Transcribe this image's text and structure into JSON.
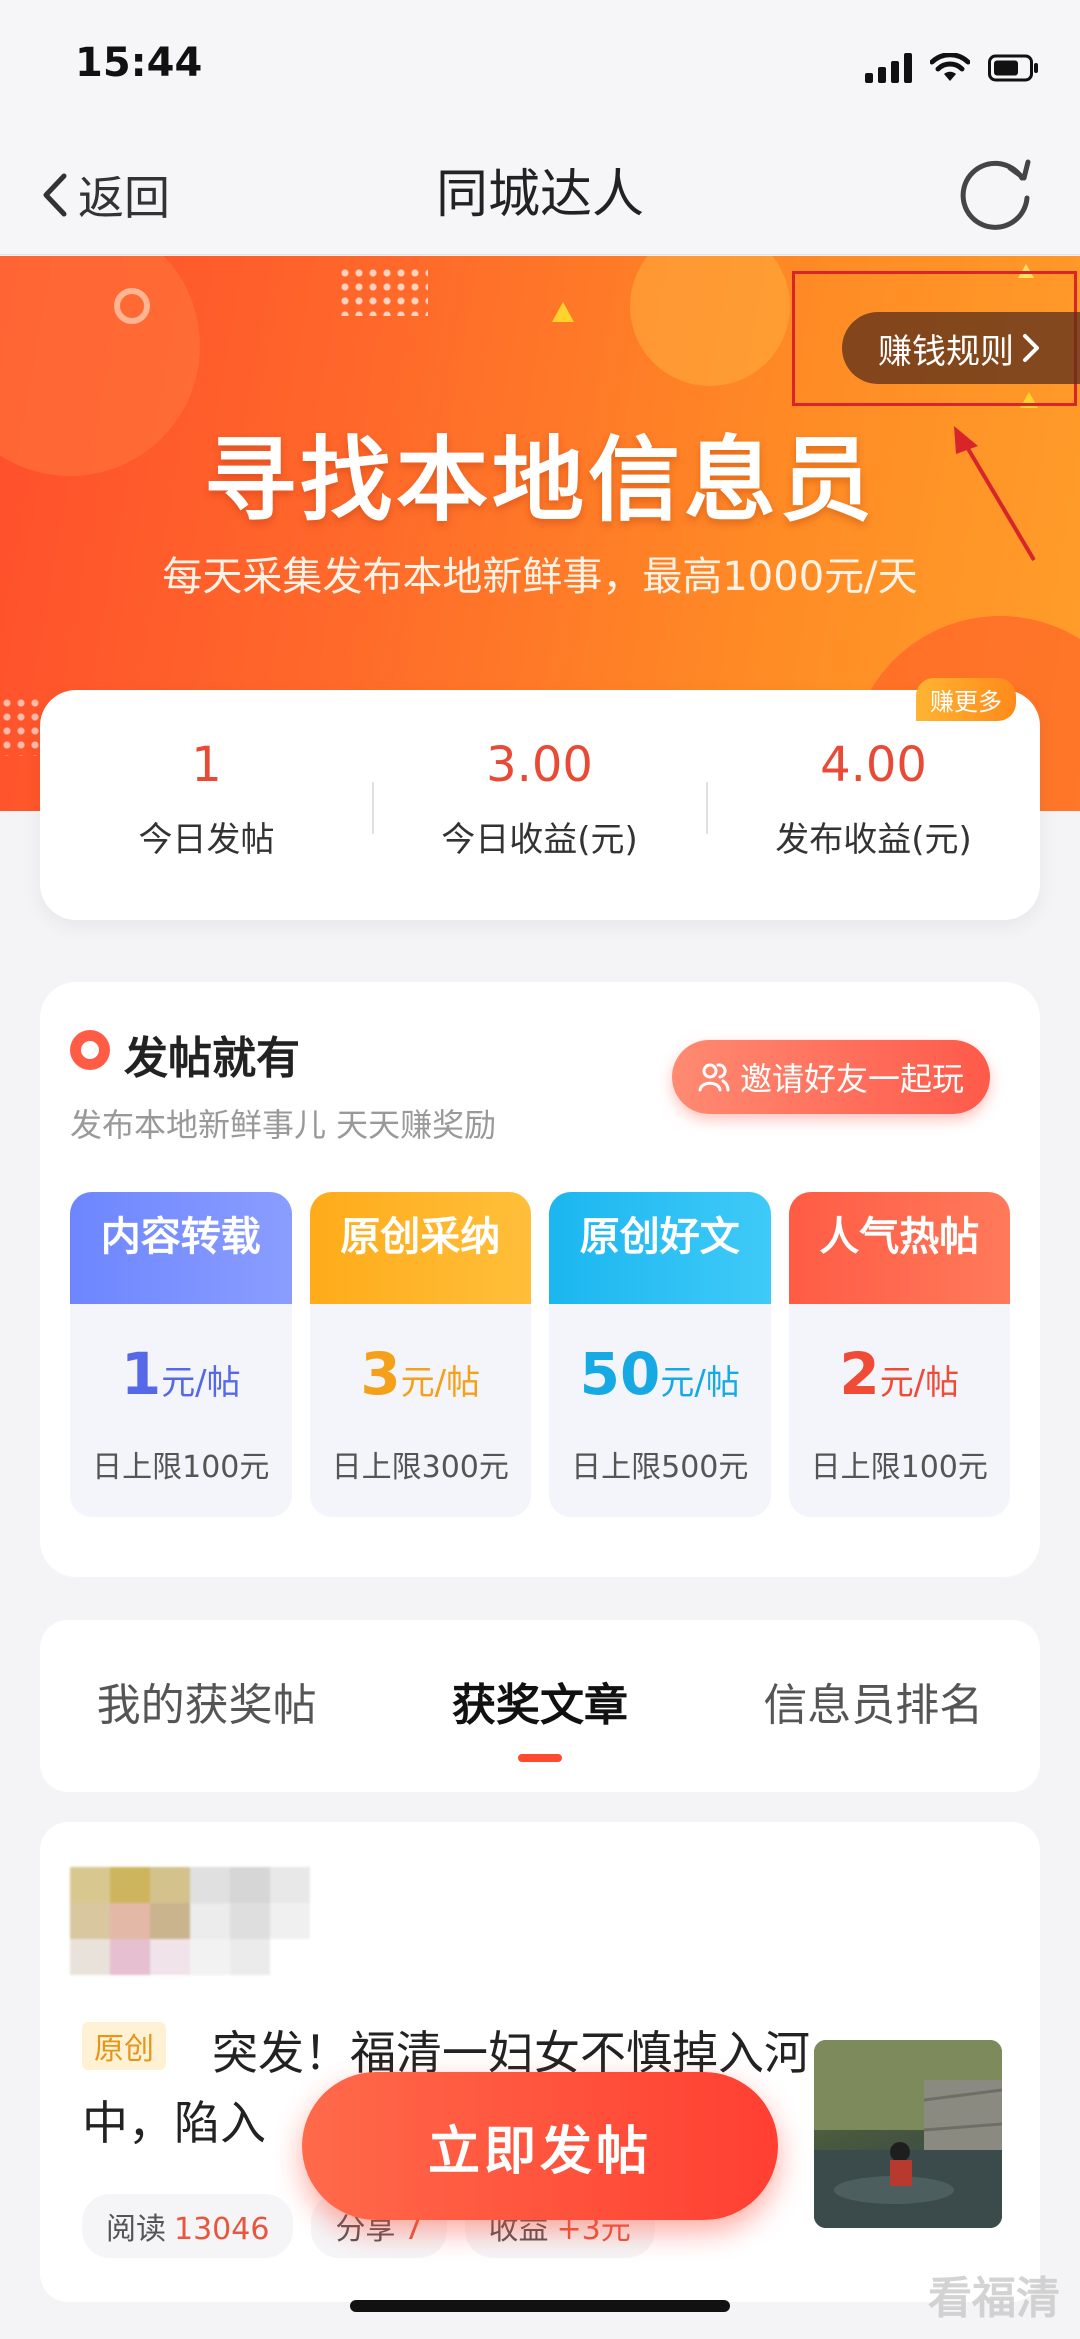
{
  "status_bar": {
    "time": "15:44"
  },
  "nav": {
    "back_label": "返回",
    "title": "同城达人"
  },
  "banner": {
    "rules_label": "赚钱规则",
    "title": "寻找本地信息员",
    "subtitle": "每天采集发布本地新鲜事，最高1000元/天"
  },
  "stats": {
    "items": [
      {
        "value": "1",
        "label": "今日发帖"
      },
      {
        "value": "3.00",
        "label": "今日收益(元)"
      },
      {
        "value": "4.00",
        "label": "发布收益(元)"
      }
    ],
    "badge": "赚更多"
  },
  "rewards": {
    "title": "发帖就有",
    "subtitle": "发布本地新鲜事儿 天天赚奖励",
    "invite_label": "邀请好友一起玩",
    "tiers": [
      {
        "name": "内容转载",
        "amount": "1",
        "unit": "元/帖",
        "limit": "日上限100元",
        "color_from": "#6d86ff",
        "color_to": "#8a9dff",
        "price_color": "#5468e8"
      },
      {
        "name": "原创采纳",
        "amount": "3",
        "unit": "元/帖",
        "limit": "日上限300元",
        "color_from": "#ffab1a",
        "color_to": "#ffbf3a",
        "price_color": "#f5a019"
      },
      {
        "name": "原创好文",
        "amount": "50",
        "unit": "元/帖",
        "limit": "日上限500元",
        "color_from": "#1bb6f0",
        "color_to": "#3fcaf8",
        "price_color": "#16a9e3"
      },
      {
        "name": "人气热帖",
        "amount": "2",
        "unit": "元/帖",
        "limit": "日上限100元",
        "color_from": "#ff5b45",
        "color_to": "#ff7a5a",
        "price_color": "#ef4b37"
      }
    ]
  },
  "tabs": [
    {
      "label": "我的获奖帖",
      "active": false
    },
    {
      "label": "获奖文章",
      "active": true
    },
    {
      "label": "信息员排名",
      "active": false
    }
  ],
  "article": {
    "tag": "原创",
    "title": "突发！福清一妇女不慎掉入河中，陷入",
    "metrics": [
      {
        "label": "阅读",
        "value": "13046"
      },
      {
        "label": "分享",
        "value": "7"
      },
      {
        "label": "收益",
        "value": "+3元"
      }
    ]
  },
  "post_button": "立即发帖",
  "watermark": "看福清",
  "colors": {
    "accent": "#ff4a2f",
    "price_red": "#e94a35"
  },
  "icons": [
    "chevron-left-icon",
    "refresh-icon",
    "chevron-right-icon",
    "users-icon"
  ]
}
